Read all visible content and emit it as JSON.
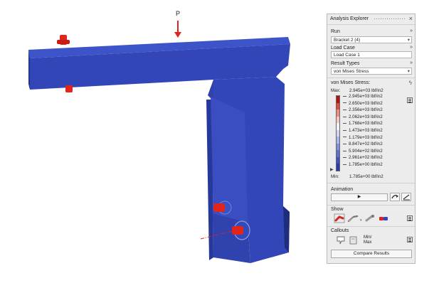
{
  "viewport": {
    "load_label": "P",
    "colors": {
      "model": "#3346b8",
      "model_dark": "#24338f",
      "model_light": "#3d54c9",
      "fastener": "#e0251d",
      "background": "#ffffff"
    }
  },
  "explorer": {
    "title": "Analysis Explorer",
    "run": {
      "label": "Run",
      "value": "Bracket 2 (4)"
    },
    "load_case": {
      "label": "Load Case",
      "value": "Load Case 1"
    },
    "result_types": {
      "label": "Result Types",
      "value": "von Mises Stress"
    },
    "legend": {
      "title": "von Mises Stress:",
      "max_label": "Max:",
      "min_label": "Min:",
      "max_value": "2.945e+03 lbf/in2",
      "min_value": "1.785e+00 lbf/in2",
      "levels": [
        "2.945e+03 lbf/in2",
        "2.650e+03 lbf/in2",
        "2.356e+03 lbf/in2",
        "2.062e+03 lbf/in2",
        "1.768e+03 lbf/in2",
        "1.473e+03 lbf/in2",
        "1.179e+03 lbf/in2",
        "8.847e+02 lbf/in2",
        "5.904e+02 lbf/in2",
        "2.961e+02 lbf/in2",
        "1.785e+00 lbf/in2"
      ],
      "colors": [
        "#b01515",
        "#e04a3a",
        "#ee8a7f",
        "#f6c5bf",
        "#f2f2f6",
        "#cfd4f3",
        "#a9b4ec",
        "#7f8fe0",
        "#5d6fd1",
        "#4052c0",
        "#2a3aa8"
      ]
    },
    "animation": {
      "label": "Animation",
      "play_glyph": "▶"
    },
    "show": {
      "label": "Show"
    },
    "callouts": {
      "label": "Callouts",
      "minmax_label_1": "Min/",
      "minmax_label_2": "Max"
    },
    "compare_button": "Compare Results"
  }
}
